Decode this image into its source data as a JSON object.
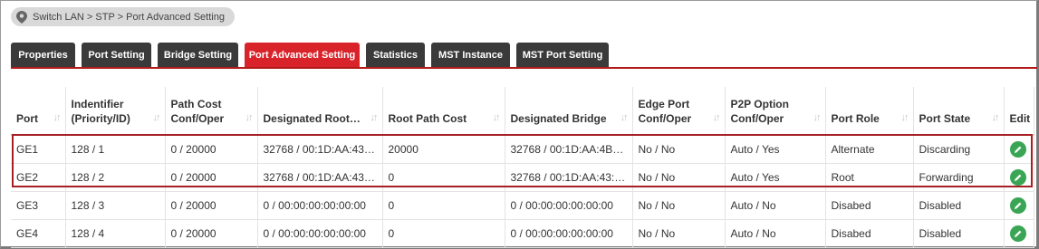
{
  "breadcrumb": "Switch LAN > STP  > Port Advanced Setting",
  "tabs": [
    {
      "label": "Properties",
      "active": false
    },
    {
      "label": "Port Setting",
      "active": false
    },
    {
      "label": "Bridge Setting",
      "active": false
    },
    {
      "label": "Port Advanced Setting",
      "active": true
    },
    {
      "label": "Statistics",
      "active": false
    },
    {
      "label": "MST Instance",
      "active": false
    },
    {
      "label": "MST Port Setting",
      "active": false
    }
  ],
  "columns": [
    {
      "line1": "Port",
      "line2": ""
    },
    {
      "line1": "Indentifier",
      "line2": "(Priority/ID)"
    },
    {
      "line1": "Path Cost",
      "line2": "Conf/Oper"
    },
    {
      "line1": "Designated Root…",
      "line2": ""
    },
    {
      "line1": "Root Path Cost",
      "line2": ""
    },
    {
      "line1": "Designated Bridge",
      "line2": ""
    },
    {
      "line1": "Edge Port",
      "line2": "Conf/Oper"
    },
    {
      "line1": "P2P Option",
      "line2": "Conf/Oper"
    },
    {
      "line1": "Port Role",
      "line2": ""
    },
    {
      "line1": "Port State",
      "line2": ""
    },
    {
      "line1": "Edit",
      "line2": ""
    }
  ],
  "rows": [
    [
      "GE1",
      "128 / 1",
      "0 / 20000",
      "32768 / 00:1D:AA:43:…",
      "20000",
      "32768 / 00:1D:AA:4B:…",
      "No / No",
      "Auto / Yes",
      "Alternate",
      "Discarding"
    ],
    [
      "GE2",
      "128 / 2",
      "0 / 20000",
      "32768 / 00:1D:AA:43:…",
      "0",
      "32768 / 00:1D:AA:43:…",
      "No / No",
      "Auto / Yes",
      "Root",
      "Forwarding"
    ],
    [
      "GE3",
      "128 / 3",
      "0 / 20000",
      "0 / 00:00:00:00:00:00",
      "0",
      "0 / 00:00:00:00:00:00",
      "No / No",
      "Auto / No",
      "Disabed",
      "Disabled"
    ],
    [
      "GE4",
      "128 / 4",
      "0 / 20000",
      "0 / 00:00:00:00:00:00",
      "0",
      "0 / 00:00:00:00:00:00",
      "No / No",
      "Auto / No",
      "Disabed",
      "Disabled"
    ]
  ],
  "colors": {
    "accent": "#d9232a",
    "tab_dark": "#3a3a3a",
    "edit_green": "#3aa655",
    "highlight": "#a61f24"
  },
  "icons": {
    "breadcrumb": "location-pin-icon",
    "sort": "sort-arrows-icon",
    "edit": "edit-pencil-icon"
  }
}
